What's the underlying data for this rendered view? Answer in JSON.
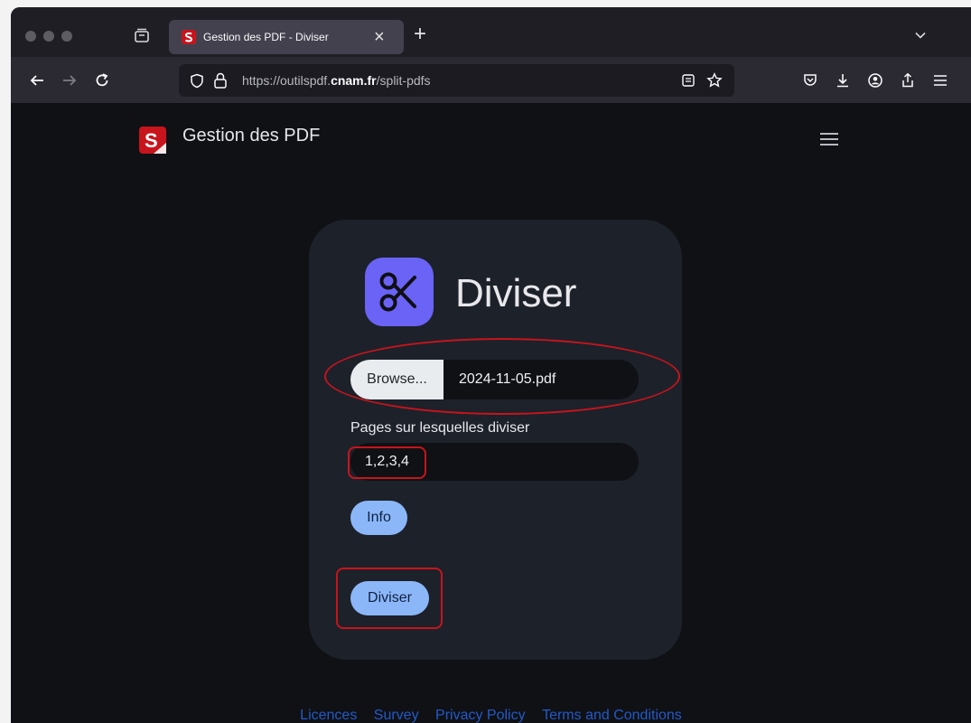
{
  "browser": {
    "tab_title": "Gestion des PDF - Diviser",
    "tab_close": "×",
    "new_tab": "+",
    "url_prefix": "https://outilspdf.",
    "url_domain": "cnam.fr",
    "url_path": "/split-pdfs"
  },
  "site": {
    "brand_letter": "S",
    "brand_name": "Gestion des PDF"
  },
  "tool": {
    "title": "Diviser",
    "browse_label": "Browse...",
    "file_name": "2024-11-05.pdf",
    "pages_label": "Pages sur lesquelles diviser",
    "pages_value": "1,2,3,4",
    "info_label": "Info",
    "submit_label": "Diviser"
  },
  "footer": {
    "links": [
      "Licences",
      "Survey",
      "Privacy Policy",
      "Terms and Conditions"
    ]
  },
  "colors": {
    "accent_icon": "#6a63f6",
    "button": "#8bb7f9",
    "annotation": "#c8141c",
    "footer_link": "#2459c8"
  }
}
